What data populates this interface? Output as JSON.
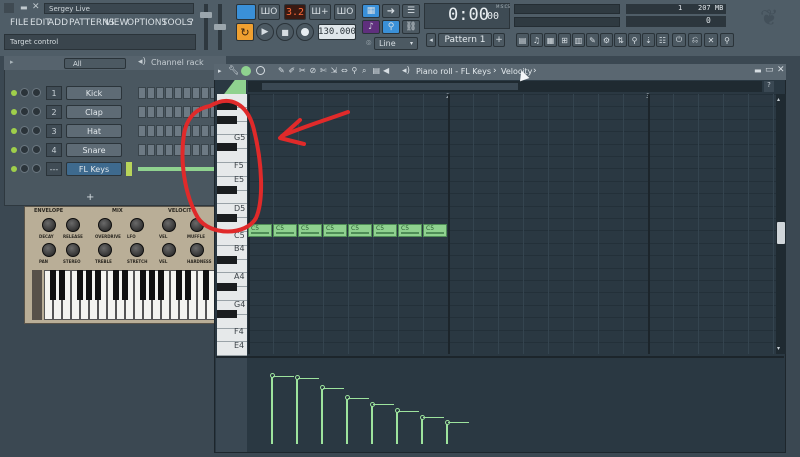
{
  "app": {
    "title": "Sergey Live",
    "hint": "Target control",
    "menu": [
      "FILE",
      "EDIT",
      "ADD",
      "PATTERNS",
      "VIEW",
      "OPTIONS",
      "TOOLS",
      "?"
    ]
  },
  "transport": {
    "pattern_toggle": "ШО",
    "record_badge": "3.2",
    "mode_a": "Ш+",
    "mode_b": "ШО",
    "tempo": "130.000",
    "time": "0:00",
    "time_frac": "00",
    "time_unit": "M:S:CS",
    "cpu_num": "1",
    "memory": "207 MB",
    "memory_sub": "0",
    "snap": "Line",
    "pattern": "Pattern 1"
  },
  "channel_rack": {
    "filter": "All",
    "title": "Channel rack",
    "add_label": "+",
    "channels": [
      {
        "num": "1",
        "name": "Kick"
      },
      {
        "num": "2",
        "name": "Clap"
      },
      {
        "num": "3",
        "name": "Hat"
      },
      {
        "num": "4",
        "name": "Snare"
      },
      {
        "num": "---",
        "name": "FL Keys"
      }
    ]
  },
  "synth": {
    "sections": [
      "ENVELOPE",
      "MIX",
      "VELOCITY"
    ],
    "knobs_row1": [
      "DECAY",
      "RELEASE",
      "OVERDRIVE",
      "LFO",
      "VEL",
      "MUFFLE"
    ],
    "knobs_row2": [
      "PAN",
      "STEREO",
      "TREBLE",
      "STRETCH",
      "VEL",
      "HARDNESS"
    ]
  },
  "piano_roll": {
    "breadcrumb_1": "Piano roll - FL Keys",
    "breadcrumb_sep": "›",
    "breadcrumb_2": "Velocity",
    "breadcrumb_end": "›",
    "bars": [
      "2",
      "3"
    ],
    "key_labels": [
      "G5",
      "F5",
      "E5",
      "D5",
      "C5",
      "B4",
      "A4",
      "G4",
      "F4",
      "E4"
    ],
    "notes": [
      {
        "label": "C5",
        "start": 0,
        "velocity": 0.95
      },
      {
        "label": "C5",
        "start": 1,
        "velocity": 0.92
      },
      {
        "label": "C5",
        "start": 2,
        "velocity": 0.78
      },
      {
        "label": "C5",
        "start": 3,
        "velocity": 0.64
      },
      {
        "label": "C5",
        "start": 4,
        "velocity": 0.55
      },
      {
        "label": "C5",
        "start": 5,
        "velocity": 0.46
      },
      {
        "label": "C5",
        "start": 6,
        "velocity": 0.37
      },
      {
        "label": "C5",
        "start": 7,
        "velocity": 0.3
      }
    ]
  },
  "colors": {
    "annotation": "#e02a2a",
    "note": "#8fd28f",
    "accent": "#f0a030"
  }
}
